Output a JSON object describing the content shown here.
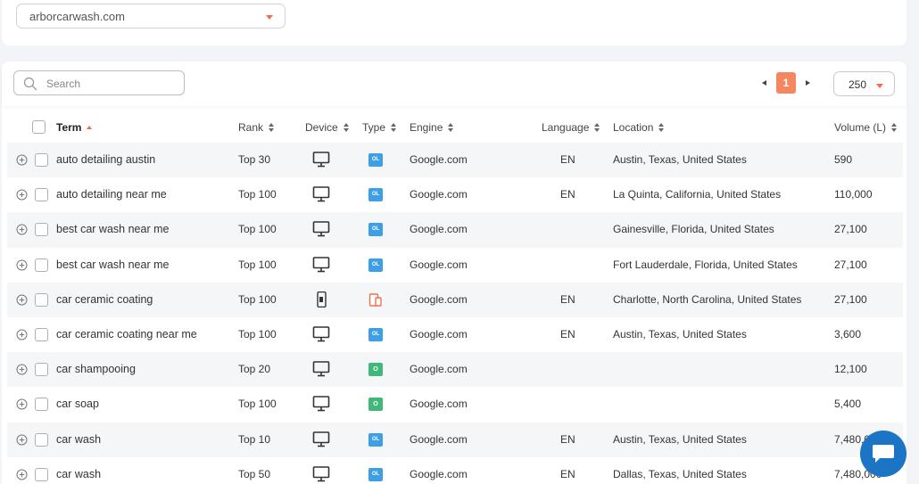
{
  "domain_select": {
    "value": "arborcarwash.com"
  },
  "search": {
    "placeholder": "Search"
  },
  "pagination": {
    "current_page": "1"
  },
  "page_size": {
    "value": "250"
  },
  "columns": {
    "term": "Term",
    "rank": "Rank",
    "device": "Device",
    "type": "Type",
    "engine": "Engine",
    "language": "Language",
    "location": "Location",
    "volume": "Volume (L)"
  },
  "rows": [
    {
      "term": "auto detailing austin",
      "rank": "Top 30",
      "device": "desktop-icon",
      "type": "OL",
      "type_color": "#3d9fe6",
      "engine": "Google.com",
      "language": "EN",
      "location": "Austin, Texas, United States",
      "volume": "590"
    },
    {
      "term": "auto detailing near me",
      "rank": "Top 100",
      "device": "desktop-icon",
      "type": "OL",
      "type_color": "#3d9fe6",
      "engine": "Google.com",
      "language": "EN",
      "location": "La Quinta, California, United States",
      "volume": "110,000"
    },
    {
      "term": "best car wash near me",
      "rank": "Top 100",
      "device": "desktop-icon",
      "type": "OL",
      "type_color": "#3d9fe6",
      "engine": "Google.com",
      "language": "",
      "location": "Gainesville, Florida, United States",
      "volume": "27,100"
    },
    {
      "term": "best car wash near me",
      "rank": "Top 100",
      "device": "desktop-icon",
      "type": "OL",
      "type_color": "#3d9fe6",
      "engine": "Google.com",
      "language": "",
      "location": "Fort Lauderdale, Florida, United States",
      "volume": "27,100"
    },
    {
      "term": "car ceramic coating",
      "rank": "Top 100",
      "device": "mobile-icon",
      "type": "",
      "type_color": "#f26c4f",
      "engine": "Google.com",
      "language": "EN",
      "location": "Charlotte, North Carolina, United States",
      "volume": "27,100"
    },
    {
      "term": "car ceramic coating near me",
      "rank": "Top 100",
      "device": "desktop-icon",
      "type": "OL",
      "type_color": "#3d9fe6",
      "engine": "Google.com",
      "language": "EN",
      "location": "Austin, Texas, United States",
      "volume": "3,600"
    },
    {
      "term": "car shampooing",
      "rank": "Top 20",
      "device": "desktop-icon",
      "type": "O",
      "type_color": "#3fb87a",
      "engine": "Google.com",
      "language": "",
      "location": "",
      "volume": "12,100"
    },
    {
      "term": "car soap",
      "rank": "Top 100",
      "device": "desktop-icon",
      "type": "O",
      "type_color": "#3fb87a",
      "engine": "Google.com",
      "language": "",
      "location": "",
      "volume": "5,400"
    },
    {
      "term": "car wash",
      "rank": "Top 10",
      "device": "desktop-icon",
      "type": "OL",
      "type_color": "#3d9fe6",
      "engine": "Google.com",
      "language": "EN",
      "location": "Austin, Texas, United States",
      "volume": "7,480,000"
    },
    {
      "term": "car wash",
      "rank": "Top 50",
      "device": "desktop-icon",
      "type": "OL",
      "type_color": "#3d9fe6",
      "engine": "Google.com",
      "language": "EN",
      "location": "Dallas, Texas, United States",
      "volume": "7,480,000"
    }
  ],
  "colors": {
    "accent": "#f26c4f",
    "page_button": "#f4875f",
    "chat_button": "#1b74c4"
  }
}
